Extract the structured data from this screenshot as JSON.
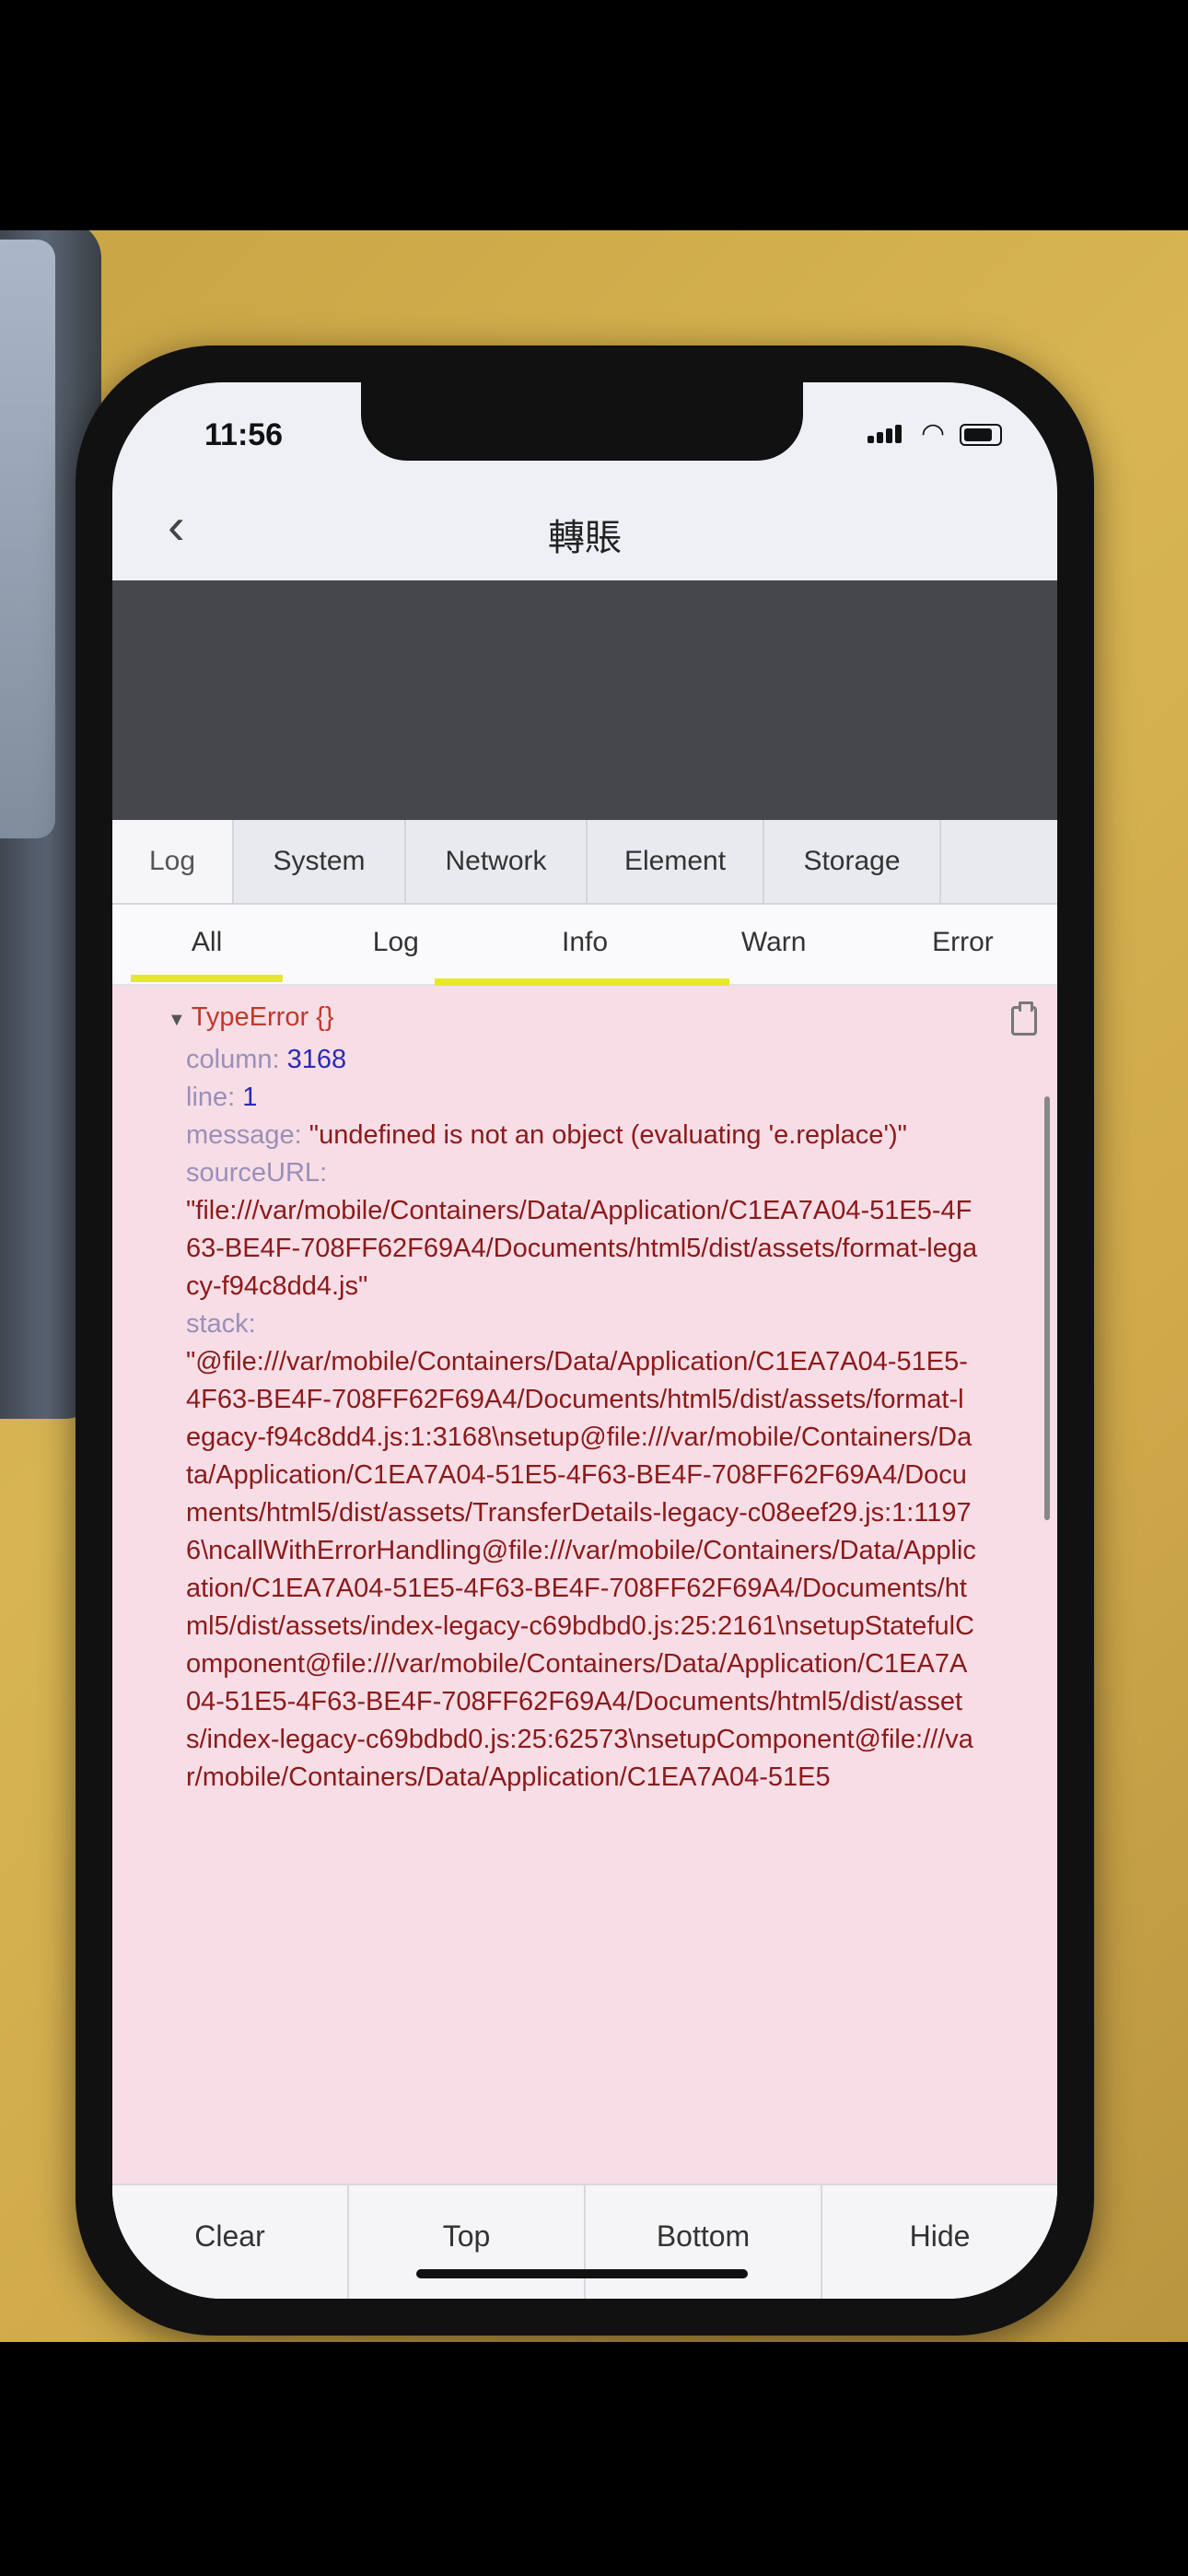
{
  "status": {
    "time": "11:56"
  },
  "nav": {
    "title": "轉賬"
  },
  "vconsole": {
    "tabs": [
      "Log",
      "System",
      "Network",
      "Element",
      "Storage"
    ],
    "subtabs": [
      "All",
      "Log",
      "Info",
      "Warn",
      "Error"
    ],
    "log": {
      "type": "TypeError {}",
      "column_key": "column",
      "column_value": "3168",
      "line_key": "line",
      "line_value": "1",
      "message_key": "message",
      "message_value": "\"undefined is not an object (evaluating 'e.replace')\"",
      "sourceurl_key": "sourceURL",
      "sourceurl_value": "\"file:///var/mobile/Containers/Data/Application/C1EA7A04-51E5-4F63-BE4F-708FF62F69A4/Documents/html5/dist/assets/format-legacy-f94c8dd4.js\"",
      "stack_key": "stack",
      "stack_value": "\"@file:///var/mobile/Containers/Data/Application/C1EA7A04-51E5-4F63-BE4F-708FF62F69A4/Documents/html5/dist/assets/format-legacy-f94c8dd4.js:1:3168\\nsetup@file:///var/mobile/Containers/Data/Application/C1EA7A04-51E5-4F63-BE4F-708FF62F69A4/Documents/html5/dist/assets/TransferDetails-legacy-c08eef29.js:1:11976\\ncallWithErrorHandling@file:///var/mobile/Containers/Data/Application/C1EA7A04-51E5-4F63-BE4F-708FF62F69A4/Documents/html5/dist/assets/index-legacy-c69bdbd0.js:25:2161\\nsetupStatefulComponent@file:///var/mobile/Containers/Data/Application/C1EA7A04-51E5-4F63-BE4F-708FF62F69A4/Documents/html5/dist/assets/index-legacy-c69bdbd0.js:25:62573\\nsetupComponent@file:///var/mobile/Containers/Data/Application/C1EA7A04-51E5"
    },
    "toolbar": [
      "Clear",
      "Top",
      "Bottom",
      "Hide"
    ]
  },
  "colors": {
    "log_background": "#f7dde6",
    "error_text": "#8b1a1a",
    "active_underline": "#e6e82c",
    "dark_panel": "#45474c"
  }
}
